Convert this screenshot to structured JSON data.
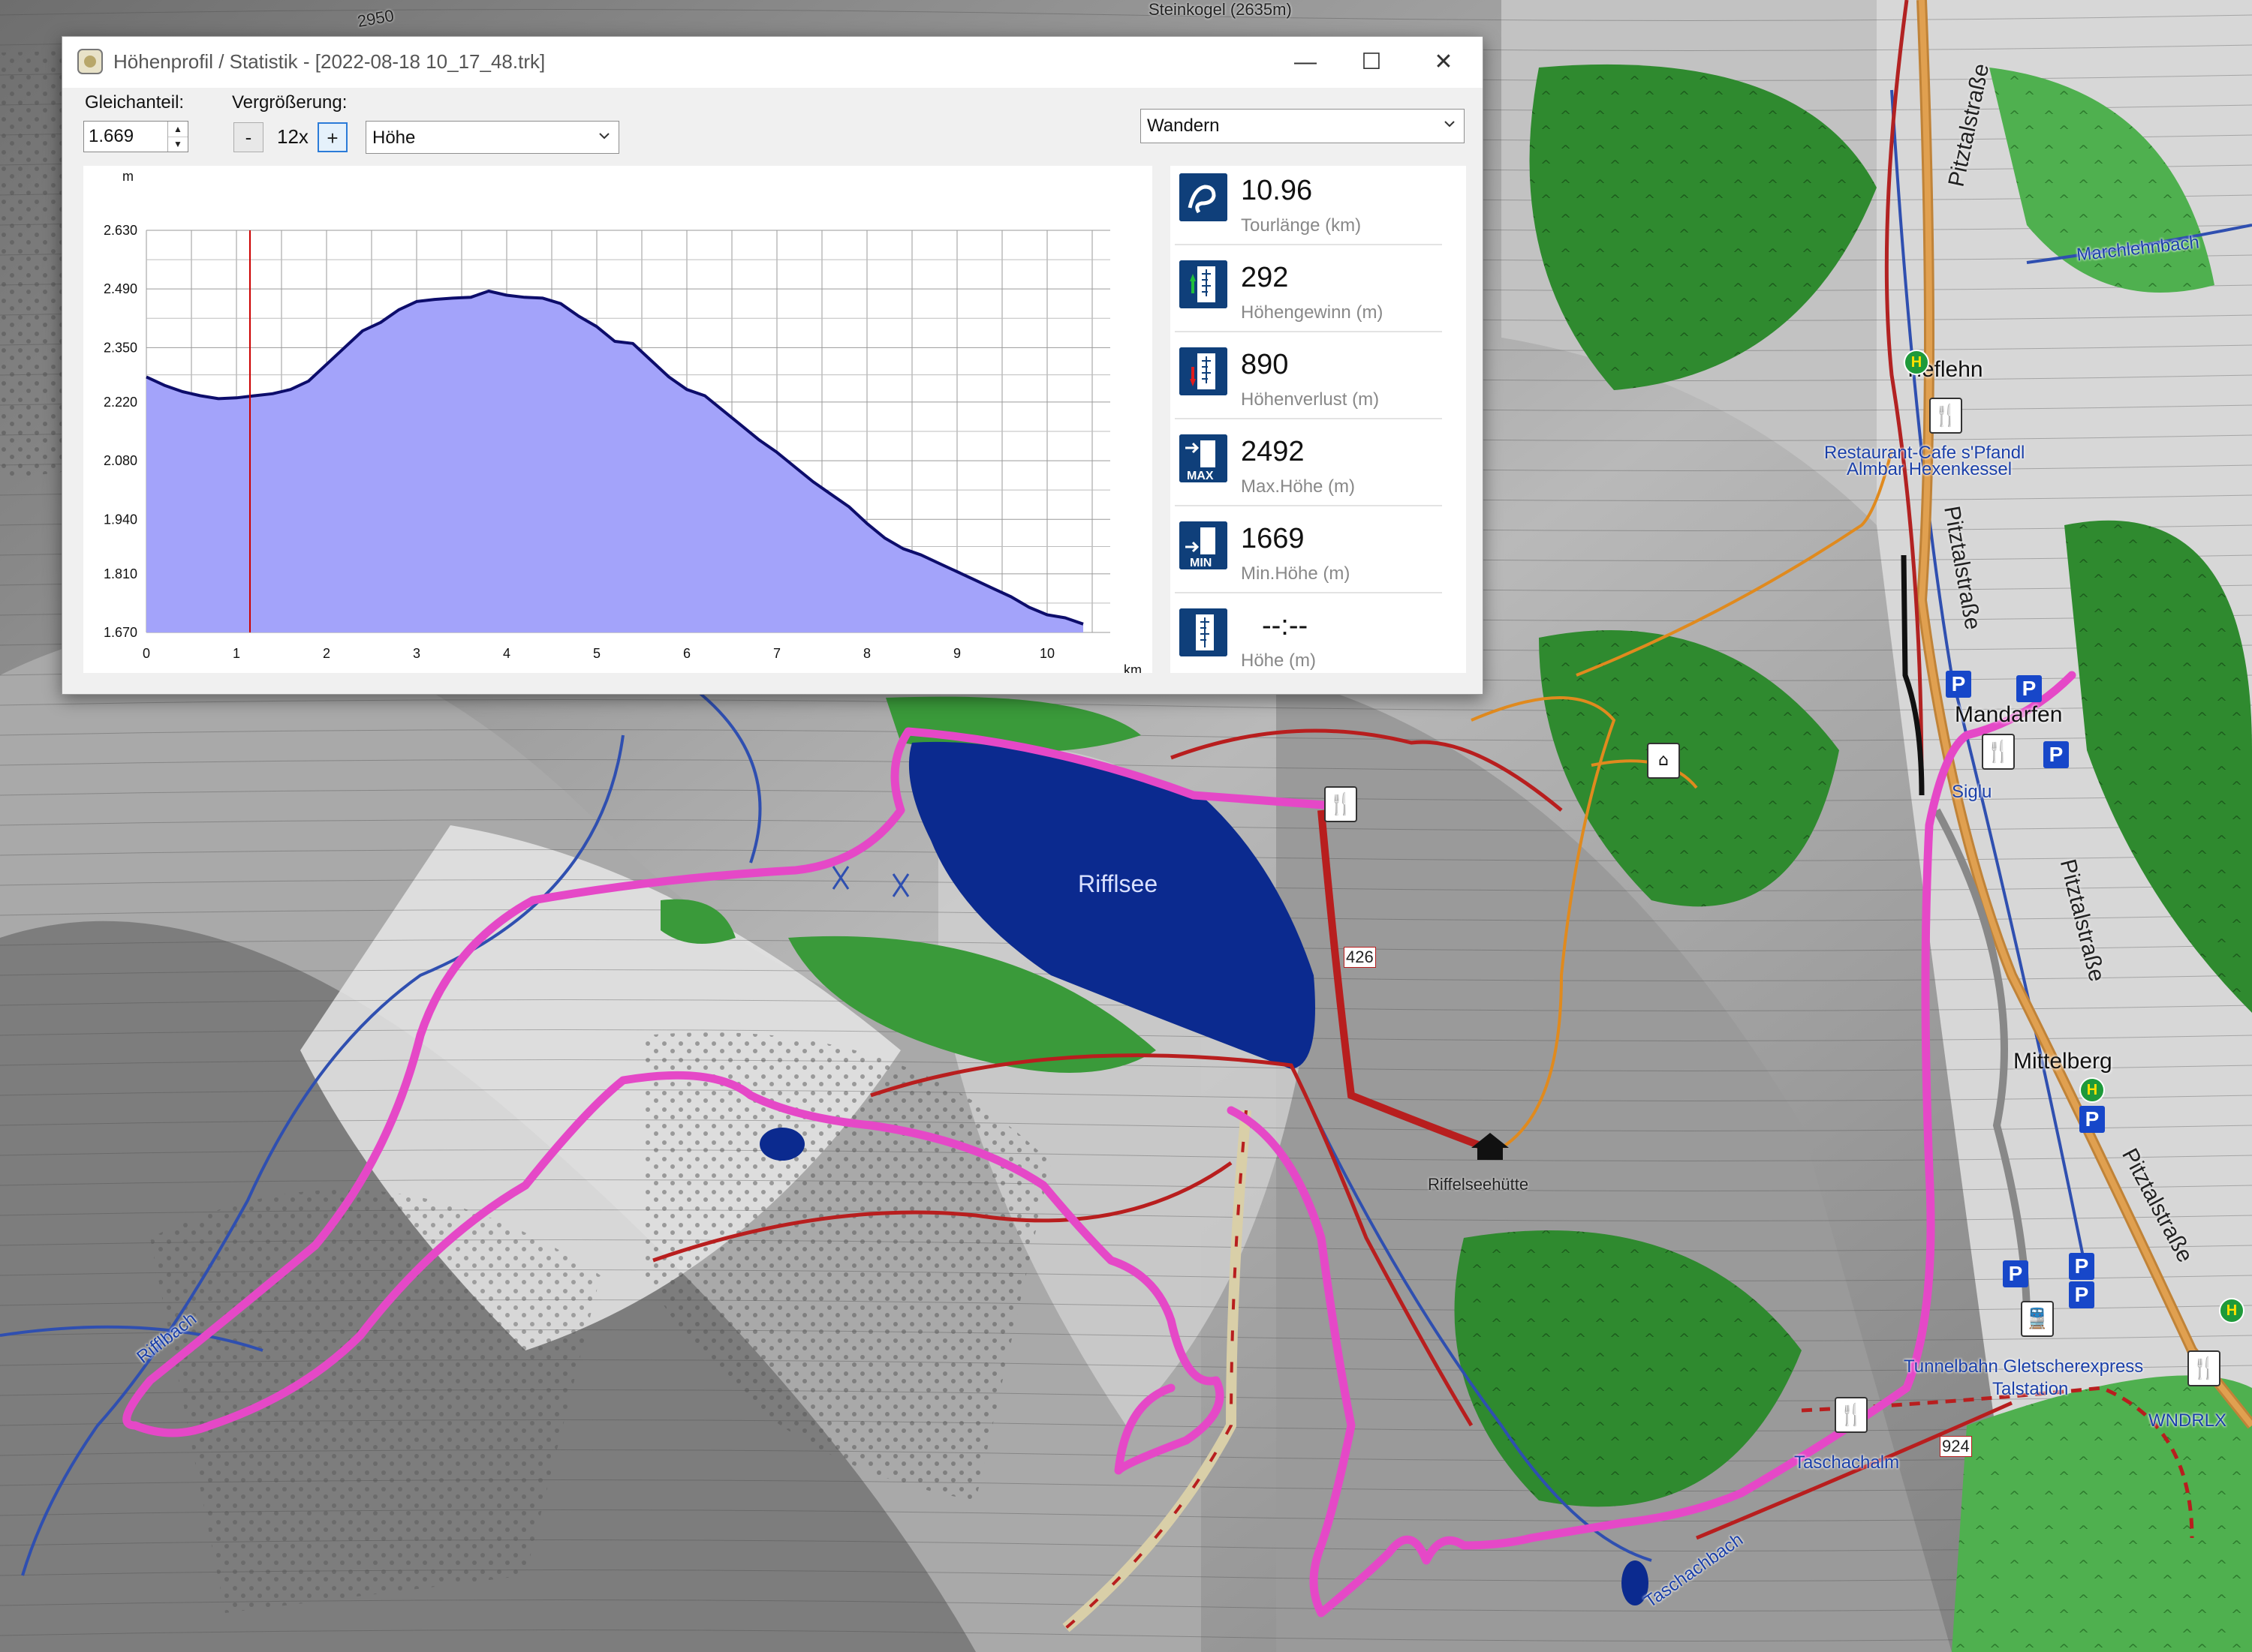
{
  "window": {
    "title": "Höhenprofil / Statistik - [2022-08-18 10_17_48.trk]",
    "minimize": "—",
    "maximize": "☐",
    "close": "✕"
  },
  "controls": {
    "gleichanteil_label": "Gleichanteil:",
    "gleichanteil_value": "1.669",
    "vergroesserung_label": "Vergrößerung:",
    "zoom_minus": "-",
    "zoom_value": "12x",
    "zoom_plus": "+",
    "profile_select": "Höhe",
    "activity_select": "Wandern"
  },
  "stats": [
    {
      "value": "10.96",
      "label": "Tourlänge (km)",
      "icon": "distance-icon"
    },
    {
      "value": "292",
      "label": "Höhengewinn (m)",
      "icon": "elevation-gain-icon"
    },
    {
      "value": "890",
      "label": "Höhenverlust (m)",
      "icon": "elevation-loss-icon"
    },
    {
      "value": "2492",
      "label": "Max.Höhe (m)",
      "icon": "max-height-icon"
    },
    {
      "value": "1669",
      "label": "Min.Höhe (m)",
      "icon": "min-height-icon"
    },
    {
      "value": "--:--",
      "label": "Höhe (m)",
      "icon": "height-icon"
    }
  ],
  "chart_data": {
    "type": "area",
    "ylabel": "m",
    "xlabel": "km",
    "x_ticks": [
      "0",
      "1",
      "2",
      "3",
      "4",
      "5",
      "6",
      "7",
      "8",
      "9",
      "10"
    ],
    "y_ticks": [
      "1.670",
      "1.810",
      "1.940",
      "2.080",
      "2.220",
      "2.350",
      "2.490",
      "2.630"
    ],
    "xlim": [
      0,
      10.7
    ],
    "ylim": [
      1670,
      2630
    ],
    "cursor_x": 1.15,
    "fill_color": "#a3a3fa",
    "line_color": "#0d0d6b",
    "cursor_color": "#cc0000",
    "grid": true,
    "series": [
      {
        "x": [
          0,
          0.2,
          0.4,
          0.6,
          0.8,
          1.0,
          1.2,
          1.4,
          1.6,
          1.8,
          2.0,
          2.2,
          2.4,
          2.6,
          2.8,
          3.0,
          3.2,
          3.4,
          3.6,
          3.8,
          4.0,
          4.2,
          4.4,
          4.6,
          4.8,
          5.0,
          5.2,
          5.4,
          5.6,
          5.8,
          6.0,
          6.2,
          6.4,
          6.6,
          6.8,
          7.0,
          7.2,
          7.4,
          7.6,
          7.8,
          8.0,
          8.2,
          8.4,
          8.6,
          8.8,
          9.0,
          9.2,
          9.4,
          9.6,
          9.8,
          10.0,
          10.2,
          10.4
        ],
        "y": [
          2280,
          2260,
          2245,
          2235,
          2228,
          2230,
          2235,
          2240,
          2250,
          2270,
          2310,
          2350,
          2390,
          2410,
          2440,
          2460,
          2465,
          2468,
          2470,
          2485,
          2475,
          2470,
          2468,
          2455,
          2425,
          2400,
          2365,
          2360,
          2320,
          2280,
          2250,
          2235,
          2200,
          2165,
          2130,
          2100,
          2065,
          2030,
          2000,
          1970,
          1930,
          1895,
          1870,
          1855,
          1835,
          1815,
          1795,
          1775,
          1755,
          1730,
          1712,
          1705,
          1690
        ]
      }
    ]
  },
  "map": {
    "labels": {
      "rifflsee": "Rifflsee",
      "tieflehn": "Tieflehn",
      "mandarfen": "Mandarfen",
      "mittelberg": "Mittelberg",
      "restaurant": "Restaurant-Cafe s'Pfandl",
      "almbar": "Almbar Hexenkessel",
      "tunnelbahn": "Tunnelbahn Gletscherexpress",
      "talstation": "Talstation",
      "wndrlx": "WNDRLX",
      "taschachalm": "Taschachalm",
      "riffelseehuette": "Riffelseehütte",
      "pitztalstrasse": "Pitztalstraße",
      "siglu": "Siglu",
      "marchlehnbach": "Marchlehnbach",
      "rifflbach": "Rifflbach",
      "taschachbach": "Taschachbach",
      "steinkogel": "Steinkogel (2635m)",
      "elev2950": "2950",
      "route426": "426",
      "route924": "924"
    }
  }
}
